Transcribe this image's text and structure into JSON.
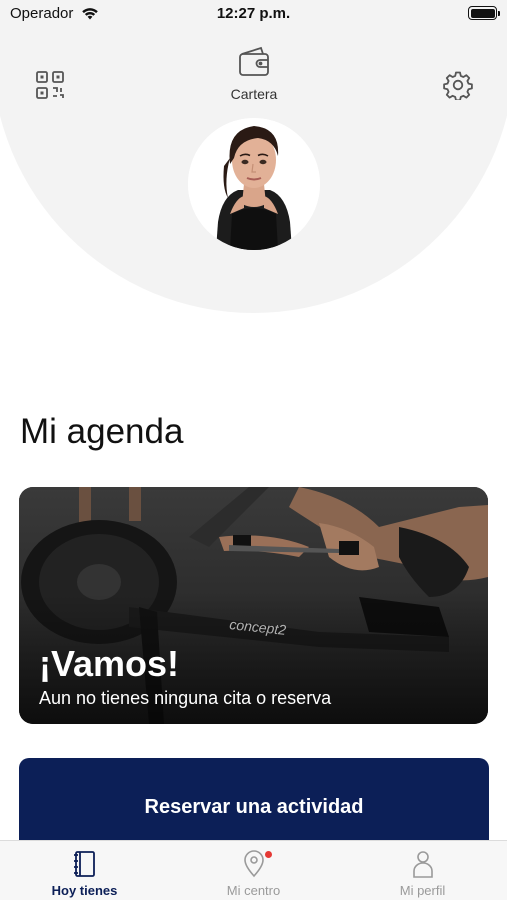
{
  "status_bar": {
    "carrier": "Operador",
    "time": "12:27 p.m."
  },
  "header": {
    "wallet_label": "Cartera"
  },
  "agenda": {
    "title": "Mi agenda",
    "card_title": "¡Vamos!",
    "card_subtitle": "Aun no tienes ninguna cita o reserva",
    "card_brand_text": "concept2",
    "book_button_label": "Reservar una actividad"
  },
  "tabs": [
    {
      "label": "Hoy tienes",
      "icon": "book-icon",
      "active": true
    },
    {
      "label": "Mi centro",
      "icon": "location-icon",
      "active": false,
      "notification": true
    },
    {
      "label": "Mi perfil",
      "icon": "person-icon",
      "active": false
    }
  ],
  "colors": {
    "brand": "#0c1f57",
    "header_bg": "#f3f3f3",
    "notification": "#e53935",
    "inactive": "#9a9a9a"
  }
}
